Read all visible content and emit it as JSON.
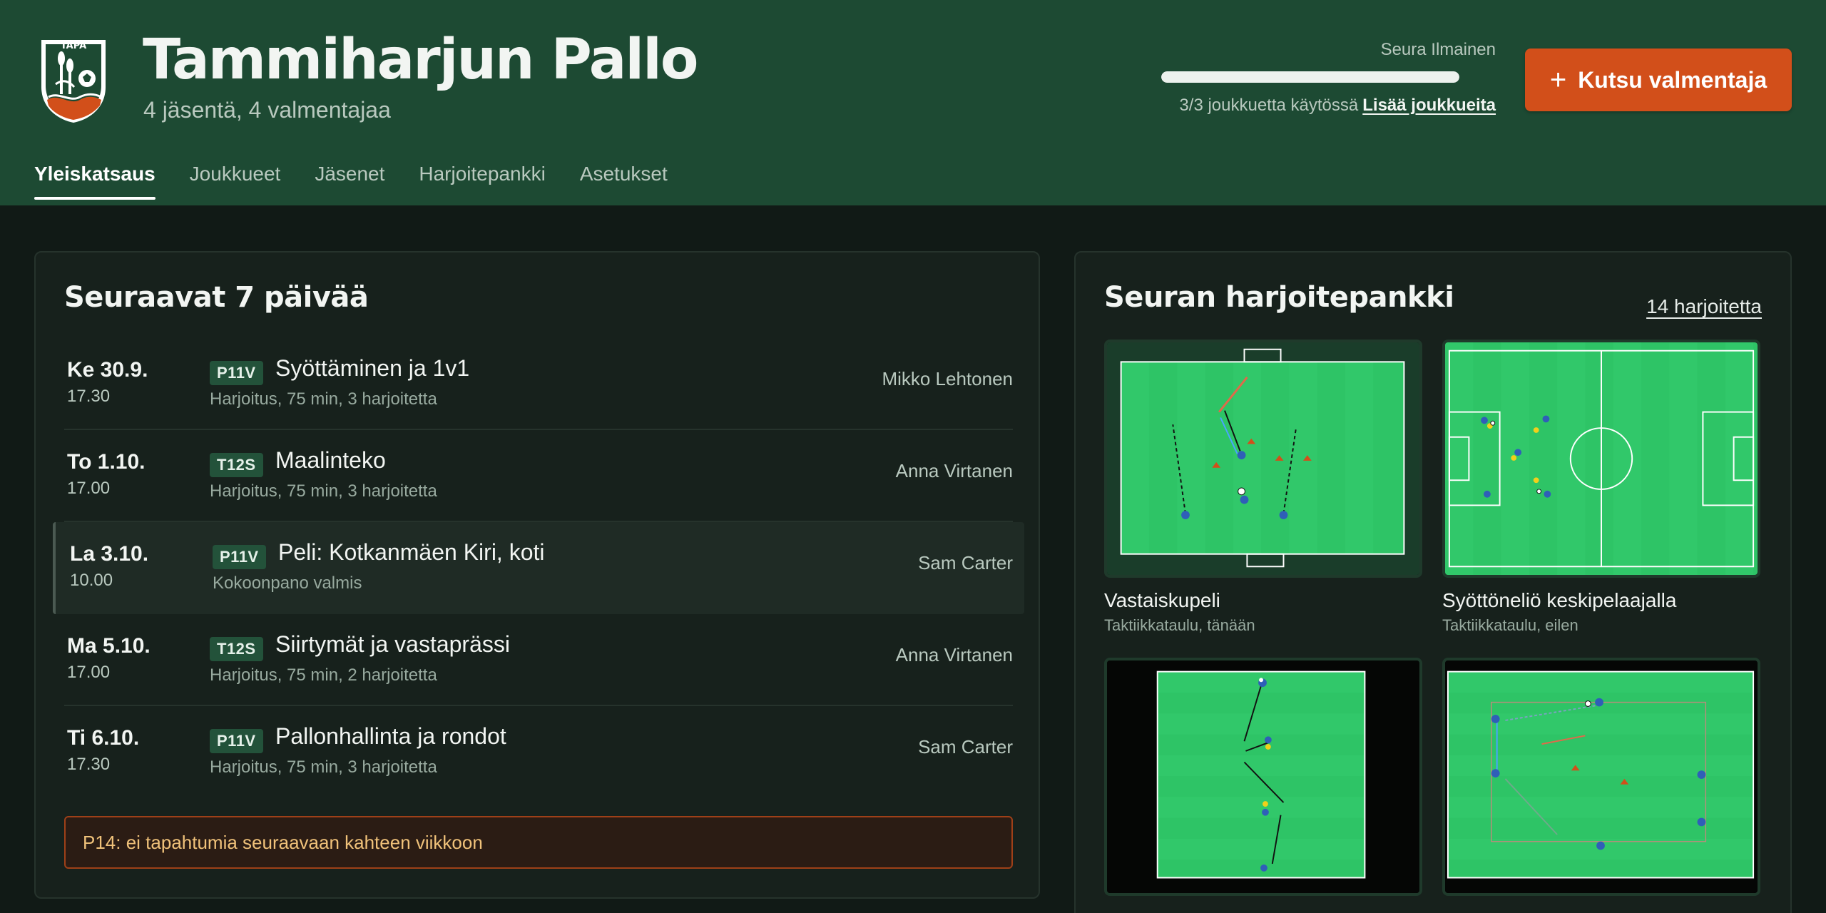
{
  "club": {
    "logo_text": "TAPA",
    "name": "Tammiharjun Pallo",
    "subtitle": "4 jäsentä, 4 valmentajaa"
  },
  "plan": {
    "name": "Seura Ilmainen",
    "usage_text": "3/3 joukkuetta käytössä",
    "usage_fraction": 1.0,
    "add_link": "Lisää joukkueita"
  },
  "invite_button": {
    "icon": "plus-icon",
    "label": "Kutsu valmentaja"
  },
  "tabs": [
    {
      "label": "Yleiskatsaus",
      "active": true
    },
    {
      "label": "Joukkueet"
    },
    {
      "label": "Jäsenet"
    },
    {
      "label": "Harjoitepankki"
    },
    {
      "label": "Asetukset"
    }
  ],
  "upcoming": {
    "title": "Seuraavat 7 päivää",
    "events": [
      {
        "day": "Ke 30.9.",
        "time": "17.30",
        "team": "P11V",
        "title": "Syöttäminen ja 1v1",
        "subtitle": "Harjoitus, 75 min, 3 harjoitetta",
        "coach": "Mikko Lehtonen"
      },
      {
        "day": "To 1.10.",
        "time": "17.00",
        "team": "T12S",
        "title": "Maalinteko",
        "subtitle": "Harjoitus, 75 min, 3 harjoitetta",
        "coach": "Anna Virtanen"
      },
      {
        "day": "La 3.10.",
        "time": "10.00",
        "team": "P11V",
        "title": "Peli: Kotkanmäen Kiri, koti",
        "subtitle": "Kokoonpano valmis",
        "coach": "Sam Carter"
      },
      {
        "day": "Ma 5.10.",
        "time": "17.00",
        "team": "T12S",
        "title": "Siirtymät ja vastaprässi",
        "subtitle": "Harjoitus, 75 min, 2 harjoitetta",
        "coach": "Anna Virtanen"
      },
      {
        "day": "Ti 6.10.",
        "time": "17.30",
        "team": "P11V",
        "title": "Pallonhallinta ja rondot",
        "subtitle": "Harjoitus, 75 min, 3 harjoitetta",
        "coach": "Sam Carter"
      }
    ],
    "notice": "P14: ei tapahtumia seuraavaan kahteen viikkoon"
  },
  "drill_bank": {
    "title": "Seuran harjoitepankki",
    "count_label": "14 harjoitetta",
    "drills": [
      {
        "title": "Vastaiskupeli",
        "subtitle": "Taktiikkataulu, tänään"
      },
      {
        "title": "Syöttöneliö keskipelaajalla",
        "subtitle": "Taktiikkataulu, eilen"
      },
      {
        "title": "",
        "subtitle": ""
      },
      {
        "title": "",
        "subtitle": ""
      }
    ]
  },
  "colors": {
    "header_bg": "#1d4a33",
    "page_bg": "#111a16",
    "accent": "#d24f1a",
    "pitch": "#2ec466"
  }
}
